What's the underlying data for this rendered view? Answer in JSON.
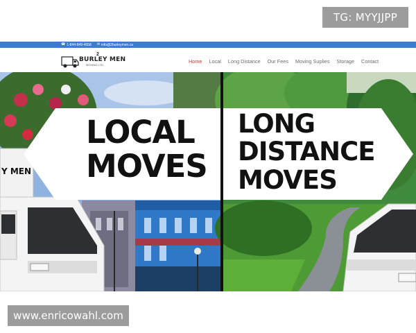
{
  "overlay": {
    "top_tag": "TG: MYYJJPP",
    "bottom_tag": "www.enricowahl.com"
  },
  "topbar": {
    "phone": "1-844-849-4558",
    "email": "info@2burleymen.ca"
  },
  "brand": {
    "name": "BURLEY MEN",
    "number": "2",
    "sub": "MOVING LTD."
  },
  "nav": {
    "items": [
      "Home",
      "Local",
      "Long Distance",
      "Our Fees",
      "Moving Suplies",
      "Storage",
      "Contact"
    ],
    "active": "Home"
  },
  "hero": {
    "left_line1": "LOCAL",
    "left_line2": "MOVES",
    "right_line1": "LONG",
    "right_line2": "DISTANCE",
    "right_line3": "MOVES",
    "truck_lettering": "Y MEN"
  },
  "colors": {
    "topbar": "#3d7bd1",
    "active_nav": "#b04a4a",
    "sky": "#8fb2e0",
    "forest": "#3f8a3c",
    "building_blue": "#2f79c8"
  }
}
